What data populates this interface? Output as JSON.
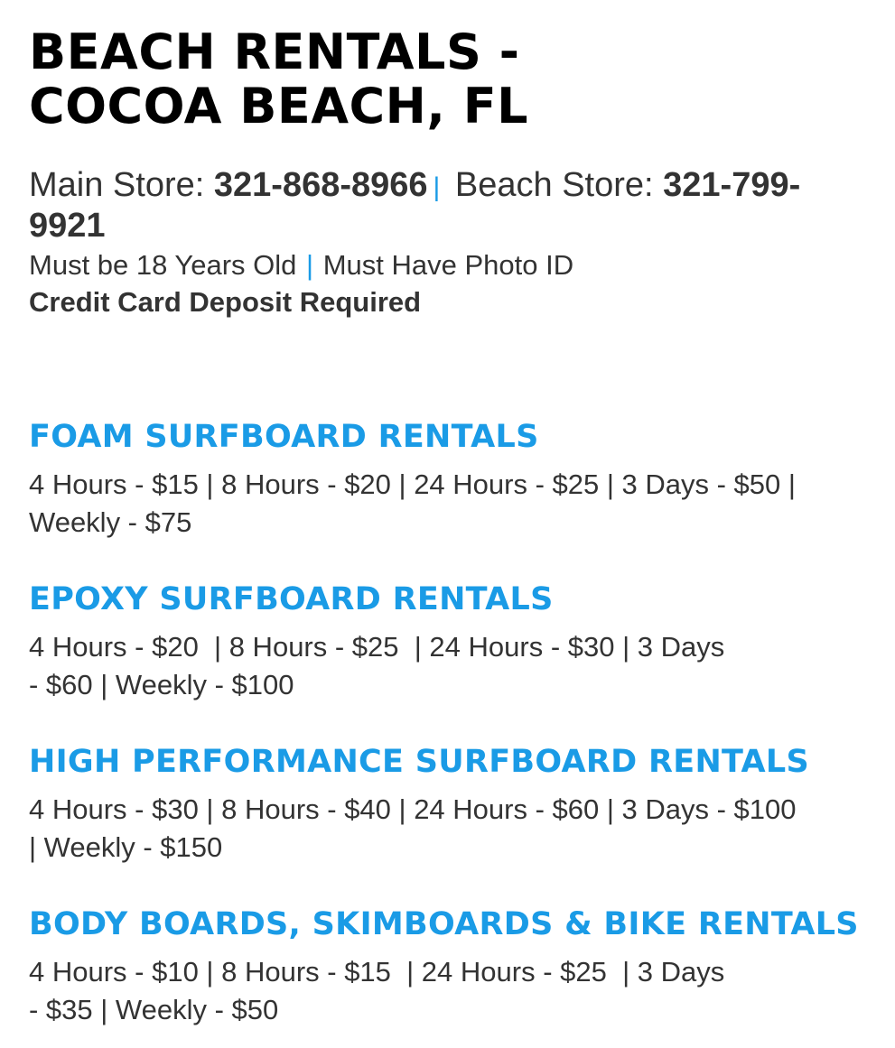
{
  "header": {
    "title": "BEACH RENTALS - COCOA BEACH, FL",
    "main_store_label": "Main Store: ",
    "main_store_phone": "321-868-8966",
    "separator": "|",
    "beach_store_label": " Beach Store: ",
    "beach_store_phone": "321-799-9921",
    "age_requirement": "Must be 18 Years Old ",
    "id_requirement": " Must Have Photo ID",
    "deposit": "Credit Card Deposit Required"
  },
  "sections": [
    {
      "title": "FOAM SURFBOARD RENTALS",
      "prices": "4 Hours - $15 | 8 Hours - $20 | 24 Hours - $25 | 3 Days - $50 |\nWeekly - $75"
    },
    {
      "title": "EPOXY SURFBOARD RENTALS",
      "prices": "4 Hours - $20  | 8 Hours - $25  | 24 Hours - $30 | 3 Days\n- $60 | Weekly - $100"
    },
    {
      "title": "HIGH PERFORMANCE SURFBOARD RENTALS",
      "prices": "4 Hours - $30 | 8 Hours - $40 | 24 Hours - $60 | 3 Days - $100\n| Weekly - $150"
    },
    {
      "title": "BODY BOARDS, SKIMBOARDS & BIKE RENTALS",
      "prices": "4 Hours - $10 | 8 Hours - $15  | 24 Hours - $25  | 3 Days\n- $35 | Weekly - $50"
    }
  ],
  "colors": {
    "accent": "#1a9be6",
    "text": "#333333",
    "title": "#000000"
  }
}
